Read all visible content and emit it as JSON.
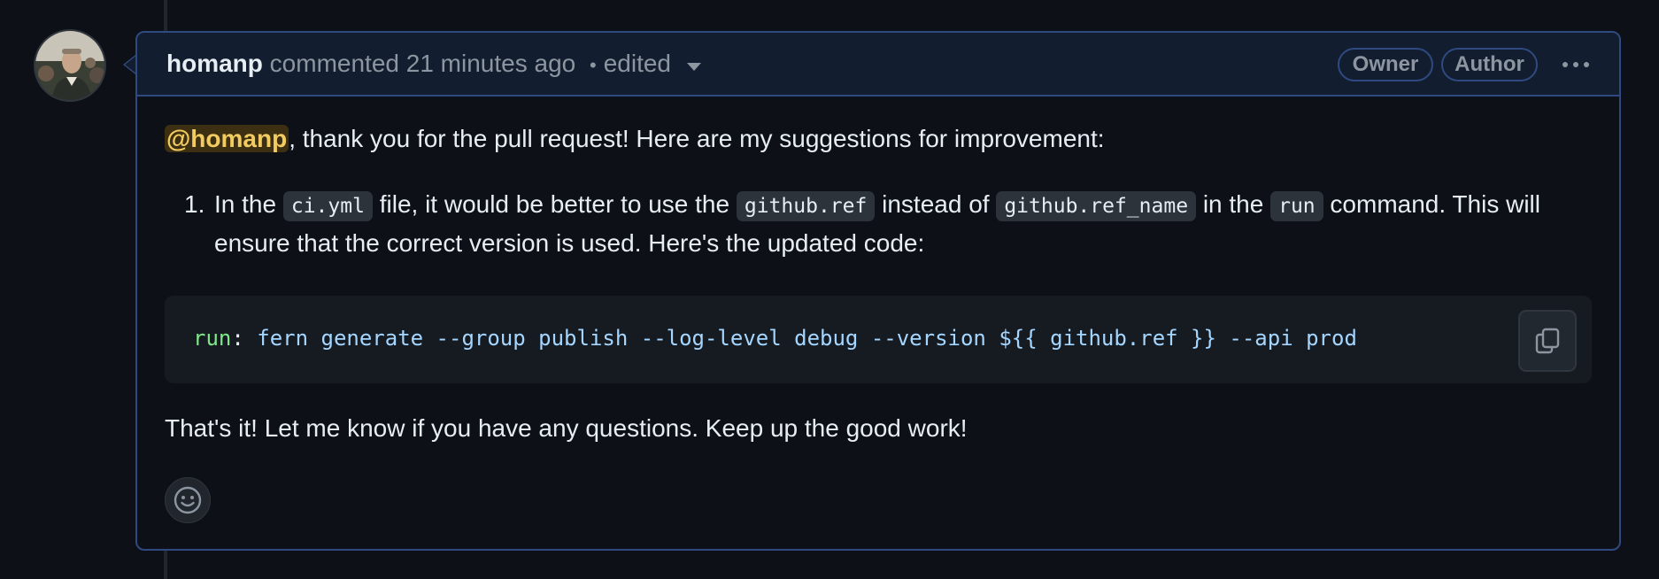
{
  "comment": {
    "author": "homanp",
    "action": "commented",
    "time_ago": "21 minutes ago",
    "separator": "•",
    "edited_label": "edited",
    "badges": {
      "owner": "Owner",
      "author": "Author"
    },
    "icons": {
      "avatar": "user-avatar-photo",
      "more": "kebab-horizontal-icon",
      "copy": "copy-icon",
      "reaction": "smiley-icon",
      "edited": "triangle-down-icon"
    }
  },
  "body": {
    "mention": "@homanp",
    "intro_rest": ", thank you for the pull request! Here are my suggestions for improvement:",
    "list": {
      "number": "1.",
      "t1": "In the ",
      "c1": "ci.yml",
      "t2": " file, it would be better to use the ",
      "c2": "github.ref",
      "t3": " instead of ",
      "c3": "github.ref_name",
      "t4": " in the ",
      "c4": "run",
      "t5": " command. This will ensure that the correct version is used. Here's the updated code:"
    },
    "code": {
      "key": "run",
      "colon": ":",
      "value": " fern generate --group publish --log-level debug --version ${{ github.ref }} --api prod"
    },
    "closing": "That's it! Let me know if you have any questions. Keep up the good work!"
  },
  "colors": {
    "background": "#0d1117",
    "header_bg": "#121d2f",
    "border_accent": "#2f4a80",
    "mention_bg": "#3d2f12",
    "mention_fg": "#f2cc60",
    "code_key": "#7ee787",
    "code_value": "#a5d6ff"
  }
}
